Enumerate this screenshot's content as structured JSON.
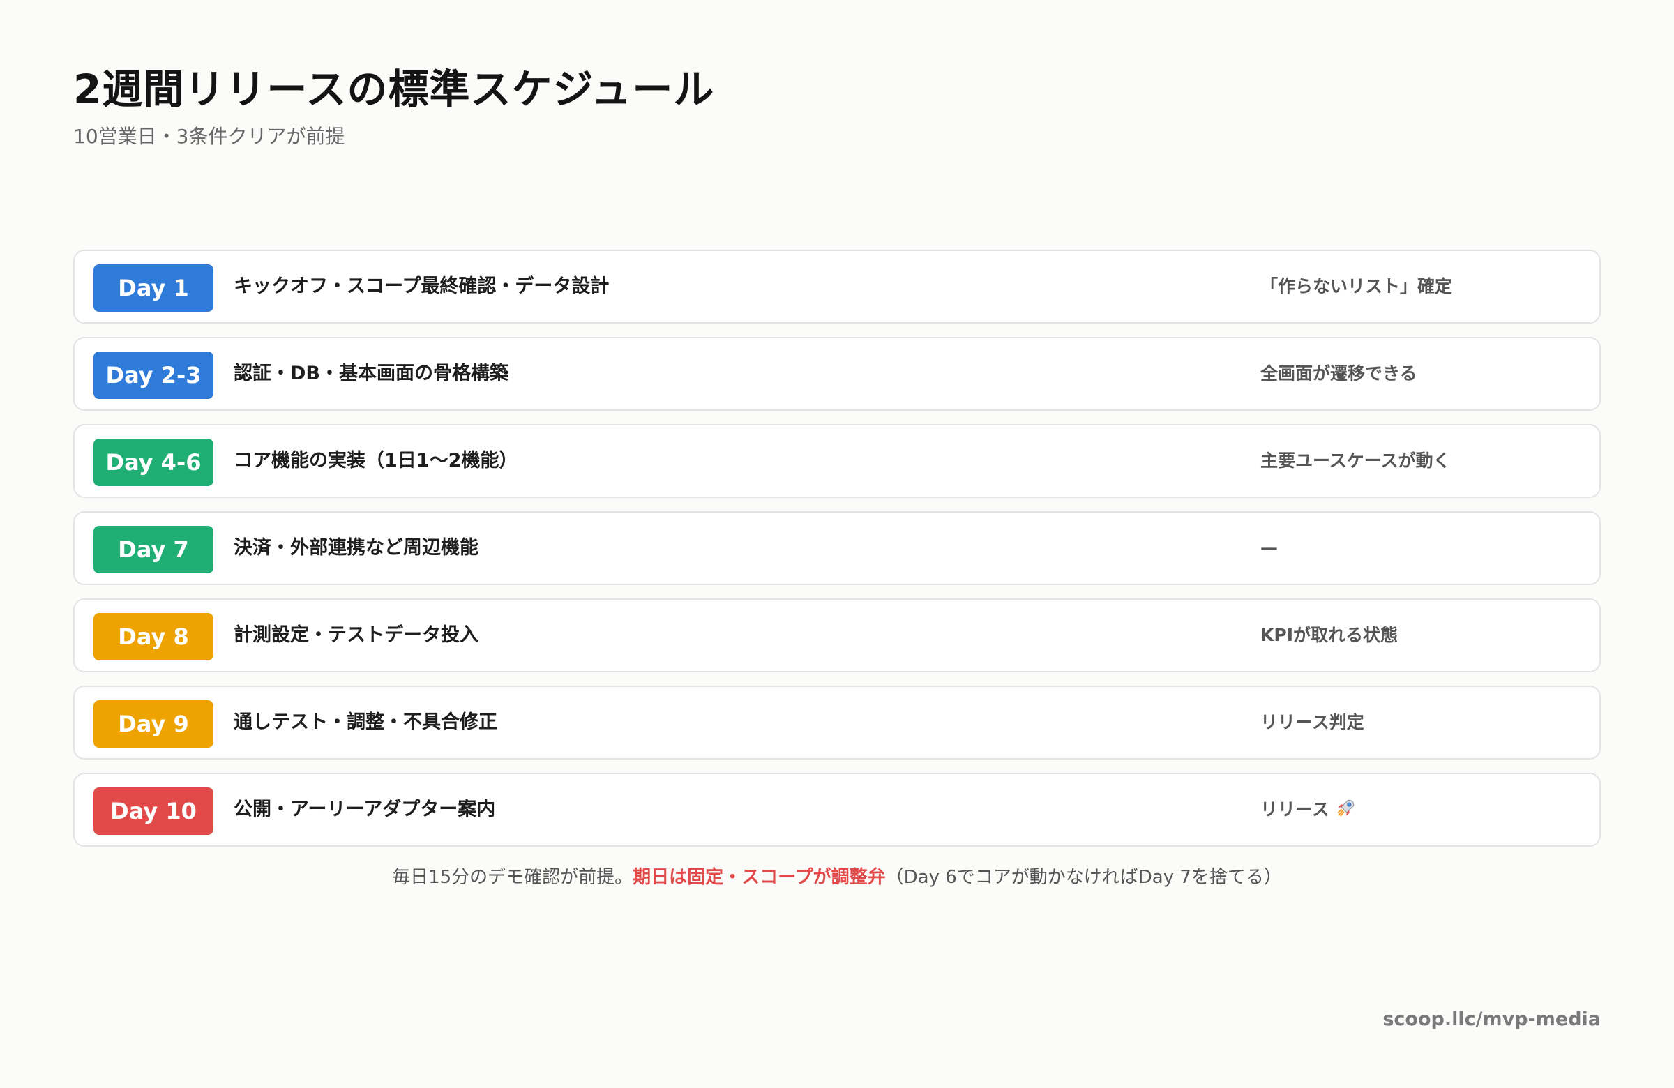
{
  "page": {
    "title": "2週間リリースの標準スケジュール",
    "subtitle": "10営業日・3条件クリアが前提"
  },
  "schedule": [
    {
      "day": "Day 1",
      "task": "キックオフ・スコープ最終確認・データ設計",
      "milestone": "「作らないリスト」確定",
      "color": "#2f7bd9"
    },
    {
      "day": "Day 2-3",
      "task": "認証・DB・基本画面の骨格構築",
      "milestone": "全画面が遷移できる",
      "color": "#2f7bd9"
    },
    {
      "day": "Day 4-6",
      "task": "コア機能の実装（1日1〜2機能）",
      "milestone": "主要ユースケースが動く",
      "color": "#1fae73"
    },
    {
      "day": "Day 7",
      "task": "決済・外部連携など周辺機能",
      "milestone": "—",
      "color": "#1fae73"
    },
    {
      "day": "Day 8",
      "task": "計測設定・テストデータ投入",
      "milestone": "KPIが取れる状態",
      "color": "#eea303"
    },
    {
      "day": "Day 9",
      "task": "通しテスト・調整・不具合修正",
      "milestone": "リリース判定",
      "color": "#eea303"
    },
    {
      "day": "Day 10",
      "task": "公開・アーリーアダプター案内",
      "milestone": "リリース",
      "milestone_icon": "rocket-icon",
      "color": "#e24a4a"
    }
  ],
  "footnote": {
    "before": "毎日15分のデモ確認が前提。",
    "emphasis": "期日は固定・スコープが調整弁",
    "after": "（Day 6でコアが動かなければDay 7を捨てる）"
  },
  "source": "scoop.llc/mvp-media"
}
